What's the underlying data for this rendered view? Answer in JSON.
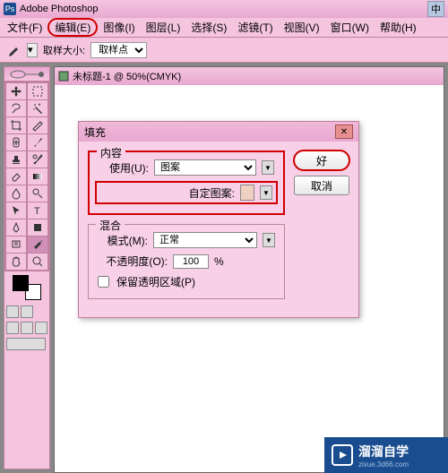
{
  "app": {
    "title": "Adobe Photoshop",
    "ext_button": "中"
  },
  "menu": {
    "file": "文件(F)",
    "edit": "编辑(E)",
    "image": "图像(I)",
    "layer": "图层(L)",
    "select": "选择(S)",
    "filter": "滤镜(T)",
    "view": "视图(V)",
    "window": "窗口(W)",
    "help": "帮助(H)"
  },
  "optionbar": {
    "sample_label": "取样大小:",
    "sample_value": "取样点"
  },
  "document": {
    "title": "未标题-1 @ 50%(CMYK)"
  },
  "dialog": {
    "title": "填充",
    "content_label": "内容",
    "use_label": "使用(U):",
    "use_value": "图案",
    "custom_pattern_label": "自定图案:",
    "blend_label": "混合",
    "mode_label": "模式(M):",
    "mode_value": "正常",
    "opacity_label": "不透明度(O):",
    "opacity_value": "100",
    "opacity_unit": "%",
    "preserve_label": "保留透明区域(P)",
    "ok": "好",
    "cancel": "取消"
  },
  "watermark": {
    "text": "溜溜自学",
    "sub": "zixue.3d66.com"
  }
}
